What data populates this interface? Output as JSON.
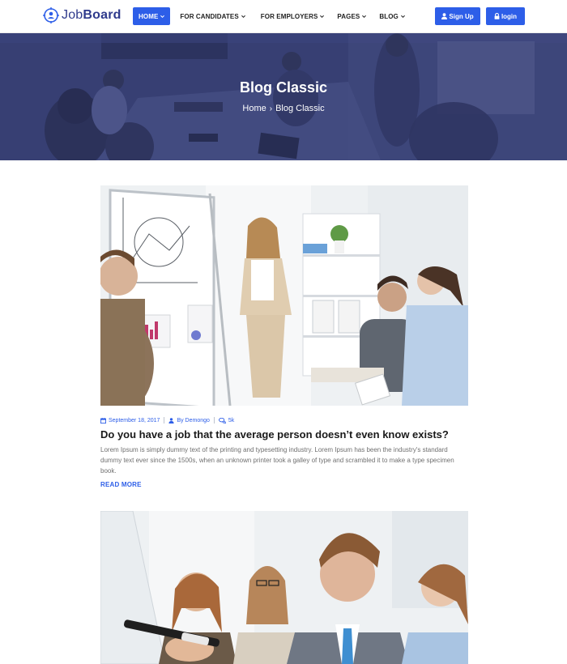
{
  "header": {
    "logo_text_light": "Job",
    "logo_text_bold": "Board",
    "nav": [
      {
        "label": "HOME",
        "active": true
      },
      {
        "label": "FOR CANDIDATES",
        "active": false
      },
      {
        "label": "FOR EMPLOYERS",
        "active": false
      },
      {
        "label": "PAGES",
        "active": false
      },
      {
        "label": "BLOG",
        "active": false
      }
    ],
    "signup_label": "Sign Up",
    "login_label": "login"
  },
  "banner": {
    "title": "Blog Classic",
    "breadcrumb": {
      "home": "Home",
      "separator": "›",
      "current": "Blog Classic"
    }
  },
  "posts": [
    {
      "date": "September 18, 2017",
      "author": "By Demongo",
      "comments": "5k",
      "title": "Do you have a job that the average person doesn’t even know exists?",
      "excerpt": "Lorem Ipsum is simply dummy text of the printing and typesetting industry. Lorem Ipsum has been the industry's standard dummy text ever since the 1500s, when an unknown printer took a galley of type and scrambled it to make a type specimen book.",
      "read_more": "READ MORE"
    }
  ],
  "colors": {
    "accent": "#2d5ee8",
    "banner_overlay": "#3a4377",
    "text_dark": "#1a1a1a",
    "text_muted": "#707070"
  },
  "icons": {
    "logo": "target-person-icon",
    "signup": "user-icon",
    "login": "lock-icon",
    "date": "calendar-icon",
    "author": "user-icon",
    "comments": "comments-icon"
  }
}
